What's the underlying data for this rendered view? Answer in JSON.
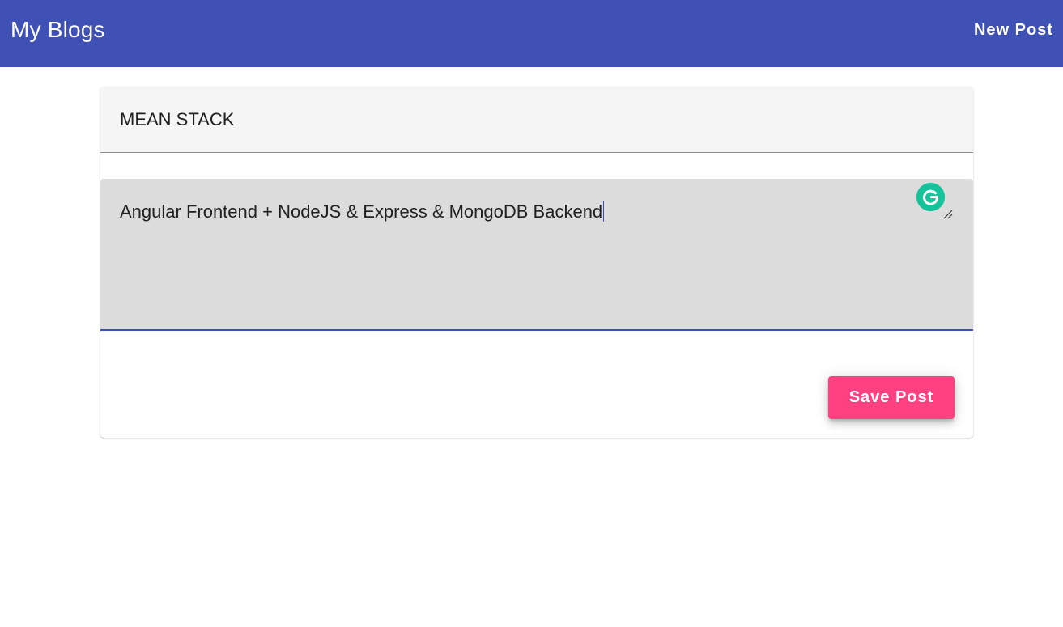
{
  "toolbar": {
    "app_title": "My Blogs",
    "new_post_label": "New Post",
    "background_color": "#3f51b5"
  },
  "post_form": {
    "title_value": "MEAN STACK",
    "content_value": "Angular Frontend + NodeJS & Express & MongoDB Backend",
    "save_label": "Save Post",
    "save_button_color": "#ff4081",
    "grammarly_icon": "grammarly-icon",
    "resize_icon": "resize-handle-icon"
  }
}
